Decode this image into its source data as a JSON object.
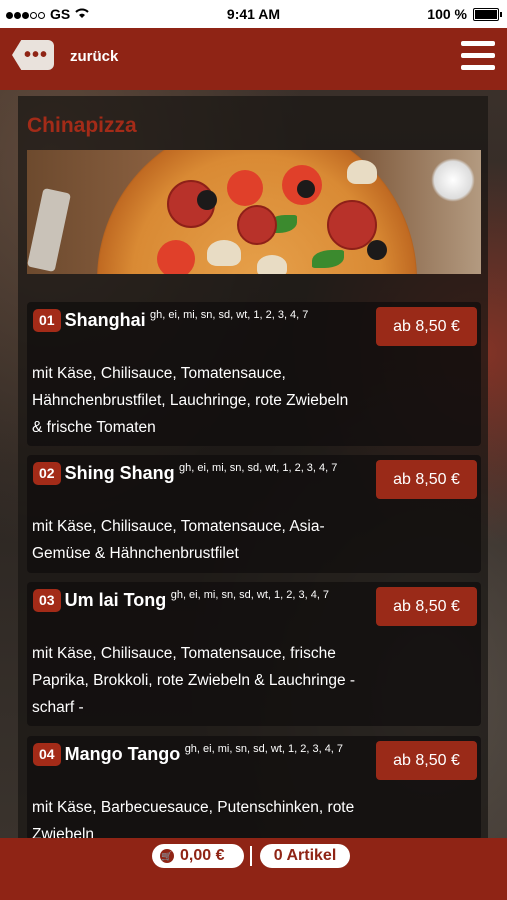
{
  "status_bar": {
    "carrier": "GS",
    "time": "9:41 AM",
    "battery": "100 %"
  },
  "header": {
    "back_label": "zurück",
    "back_icon": "back-dots-icon",
    "menu_icon": "hamburger-menu-icon"
  },
  "section": {
    "title": "Chinapizza"
  },
  "items": [
    {
      "number": "01",
      "name": "Shanghai",
      "allergens": "gh, ei, mi, sn, sd, wt, 1, 2, 3, 4, 7",
      "description": "mit Käse, Chilisauce, Tomatensauce, Hähnchenbrustfilet, Lauchringe, rote Zwiebeln & frische Tomaten",
      "price": "ab 8,50 €"
    },
    {
      "number": "02",
      "name": "Shing Shang",
      "allergens": "gh, ei, mi, sn, sd, wt, 1, 2, 3, 4, 7",
      "description": "mit Käse, Chilisauce, Tomatensauce, Asia-Gemüse & Hähnchenbrustfilet",
      "price": "ab 8,50 €"
    },
    {
      "number": "03",
      "name": "Um lai Tong",
      "allergens": "gh, ei, mi, sn, sd, wt, 1, 2, 3, 4, 7",
      "description": "mit Käse, Chilisauce, Tomatensauce, frische Paprika, Brokkoli, rote Zwiebeln & Lauchringe - scharf -",
      "price": "ab 8,50 €"
    },
    {
      "number": "04",
      "name": "Mango Tango",
      "allergens": "gh, ei, mi, sn, sd, wt, 1, 2, 3, 4, 7",
      "description": "mit Käse, Barbecuesauce, Putenschinken, rote Zwiebeln",
      "price": "ab 8,50 €"
    }
  ],
  "footer": {
    "cart_total": "0,00 €",
    "cart_icon": "shopping-cart-icon",
    "item_count": "0 Artikel"
  },
  "colors": {
    "brand": "#8f2415",
    "accent": "#a32b18"
  }
}
